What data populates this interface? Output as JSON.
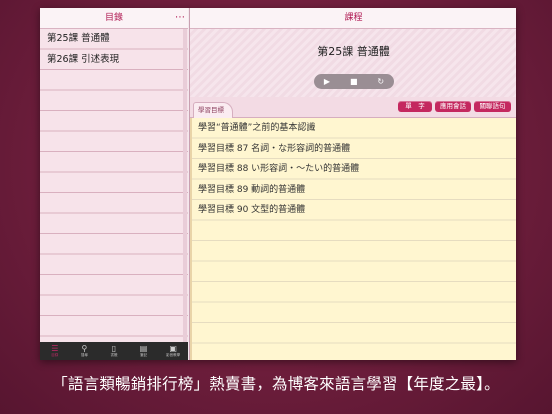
{
  "left_pane": {
    "title": "目錄",
    "more_icon": "⋯",
    "lessons": [
      {
        "label": "第25課 普通體"
      },
      {
        "label": "第26課 引述表現"
      }
    ],
    "tabbar": [
      {
        "icon": "list-icon",
        "glyph": "☰",
        "label": "目錄",
        "active": true
      },
      {
        "icon": "search-icon",
        "glyph": "⚲",
        "label": "搜尋",
        "active": false
      },
      {
        "icon": "book-icon",
        "glyph": "▯",
        "label": "書籤",
        "active": false
      },
      {
        "icon": "notes-icon",
        "glyph": "▤",
        "label": "筆記",
        "active": false
      },
      {
        "icon": "video-icon",
        "glyph": "▣",
        "label": "影音教學",
        "active": false
      }
    ]
  },
  "right_pane": {
    "title": "課程",
    "lesson_title": "第25課 普通體",
    "player": {
      "play": "▶",
      "stop": "■",
      "repeat": "↻"
    },
    "tab_label": "學習目標",
    "buttons": {
      "vocab": "單　字",
      "conversation": "應用會話",
      "related": "關聯語句"
    },
    "objectives": [
      "學習“普通體”之前的基本認識",
      "學習目標 87 名詞・な形容詞的普通體",
      "學習目標 88 い形容詞・～たい的普通體",
      "學習目標 89 動詞的普通體",
      "學習目標 90 文型的普通體"
    ]
  },
  "caption": "「語言類暢銷排行榜」熱賣書，為博客來語言學習【年度之最】。",
  "colors": {
    "accent": "#b01a53",
    "button": "#c4285f",
    "background": "#6e1e3c"
  }
}
